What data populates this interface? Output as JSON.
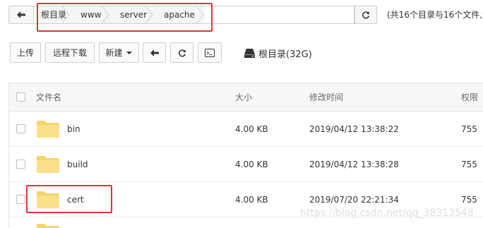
{
  "path_bar": {
    "crumbs": [
      "根目录",
      "www",
      "server",
      "apache"
    ],
    "summary": "(共16个目录与16个文件,大"
  },
  "toolbar": {
    "upload_label": "上传",
    "remote_download_label": "远程下载",
    "new_label": "新建",
    "disk_label": "根目录(32G)"
  },
  "table": {
    "headers": {
      "name": "文件名",
      "size": "大小",
      "modified": "修改时间",
      "perm": "权限"
    },
    "rows": [
      {
        "name": "bin",
        "size": "4.00 KB",
        "modified": "2019/04/12 13:38:22",
        "perm": "755"
      },
      {
        "name": "build",
        "size": "4.00 KB",
        "modified": "2019/04/12 13:38:28",
        "perm": "755"
      },
      {
        "name": "cert",
        "size": "4.00 KB",
        "modified": "2019/07/20 22:21:34",
        "perm": "755"
      }
    ]
  },
  "watermark": "https://blog.csdn.net/qq_38313548",
  "colors": {
    "highlight": "#d9363e",
    "folder": "#fbe08a",
    "folder_tab": "#f5d46c"
  },
  "icons": {
    "back": "arrow-left-icon",
    "refresh": "refresh-icon",
    "terminal": "terminal-icon",
    "disk": "hard-drive-icon",
    "folder": "folder-icon"
  }
}
